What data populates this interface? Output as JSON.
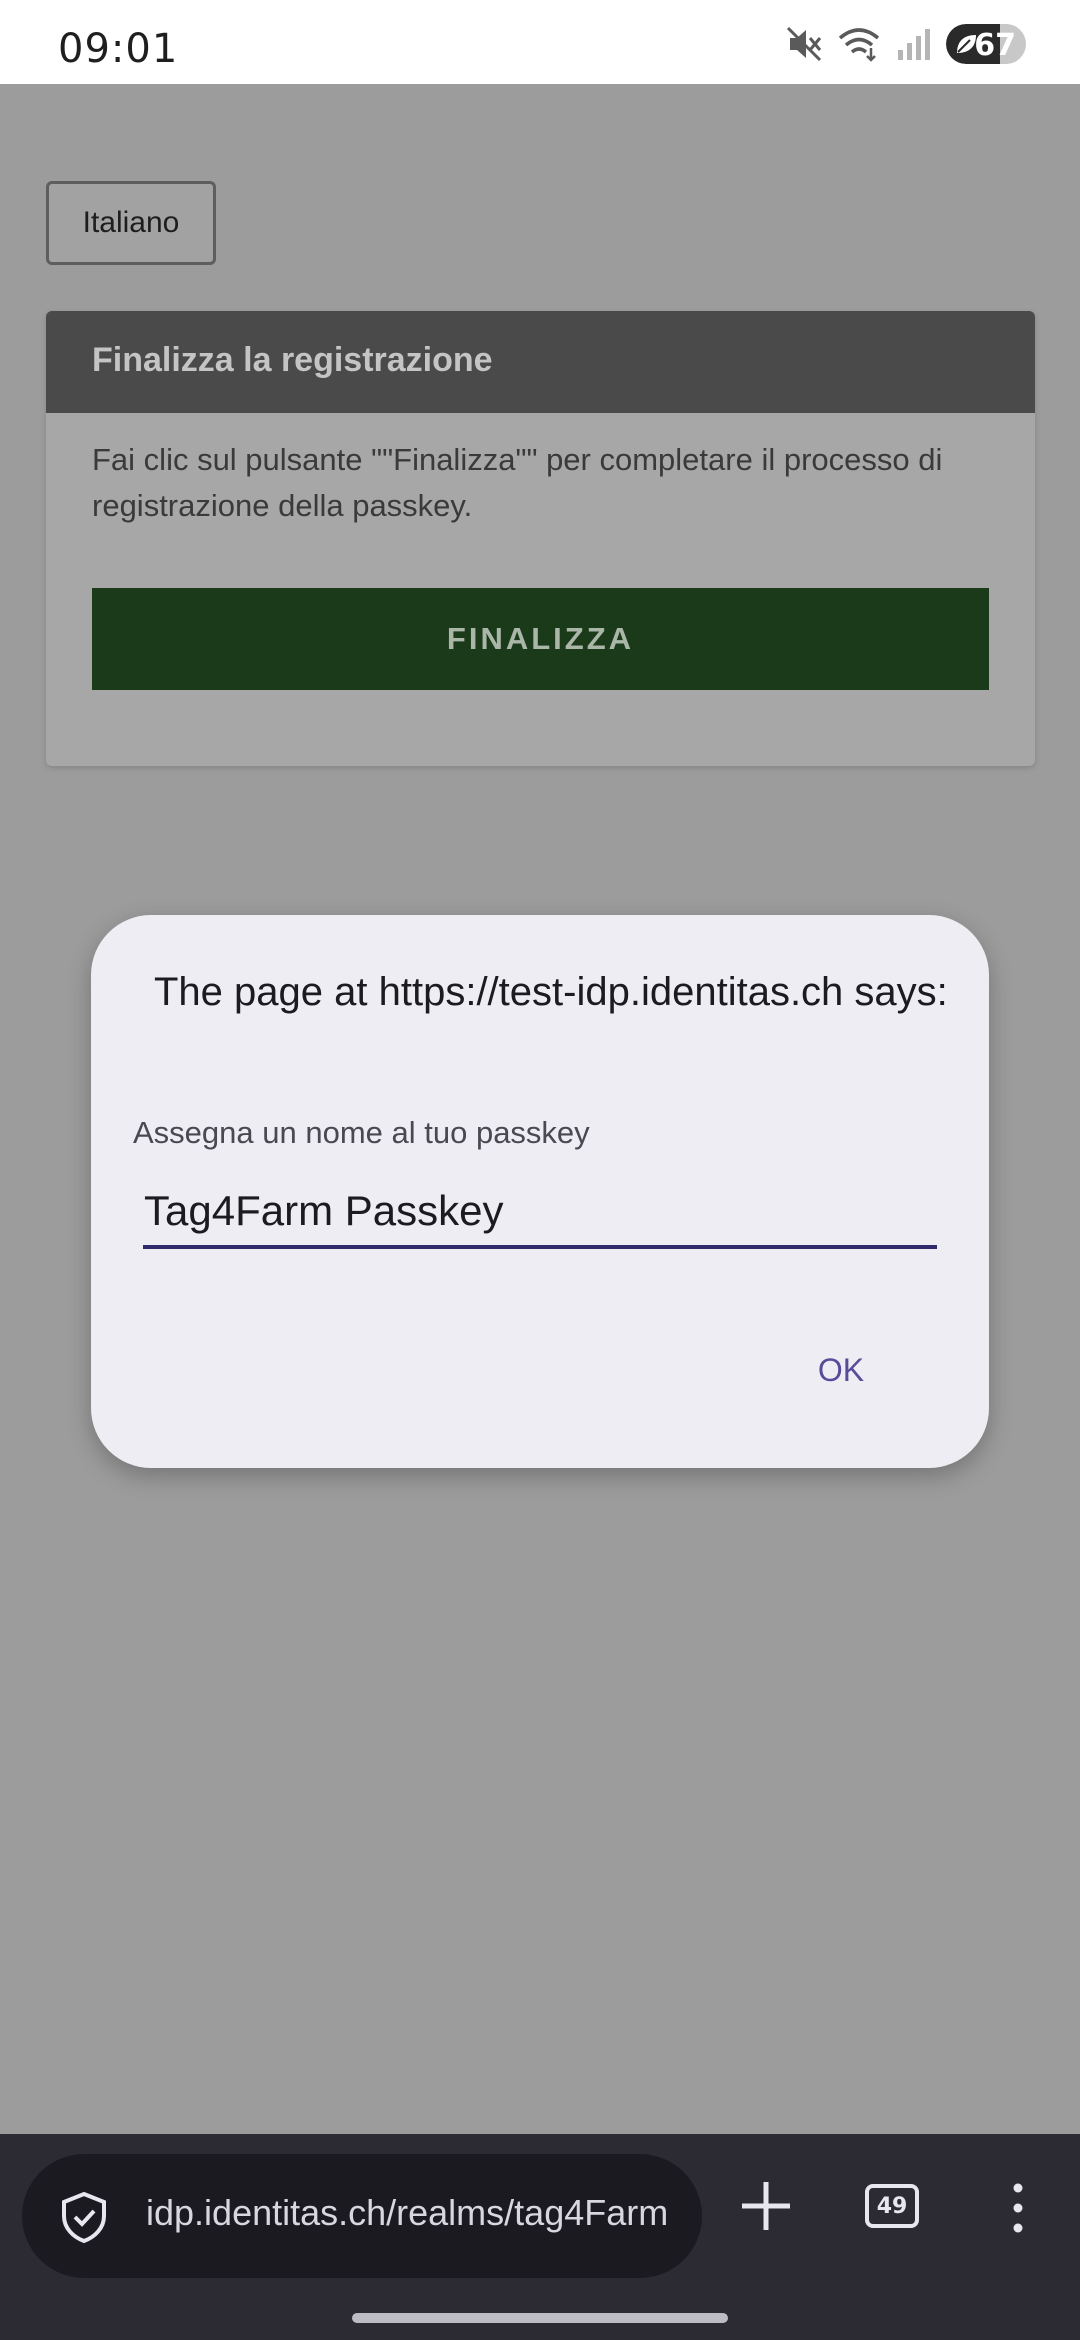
{
  "status_bar": {
    "time": "09:01",
    "battery_level": "67",
    "icons": [
      "mute-icon",
      "wifi-icon",
      "signal-icon",
      "battery-icon"
    ]
  },
  "page": {
    "language_button": "Italiano",
    "card": {
      "title": "Finalizza la registrazione",
      "text": "Fai clic sul pulsante \"\"Finalizza\"\" per completare il processo di registrazione della passkey.",
      "button_label": "FINALIZZA"
    }
  },
  "dialog": {
    "title": "The page at https://test-idp.identitas.ch says:",
    "label": "Assegna un nome al tuo passkey",
    "input_value": "Tag4Farm Passkey",
    "ok_label": "OK"
  },
  "browser_bar": {
    "url": "idp.identitas.ch/realms/tag4Farm",
    "tab_count": "49"
  },
  "colors": {
    "finalize_button": "#1b3a1a",
    "dialog_background": "#eeedf3",
    "accent": "#5a4a9a"
  }
}
